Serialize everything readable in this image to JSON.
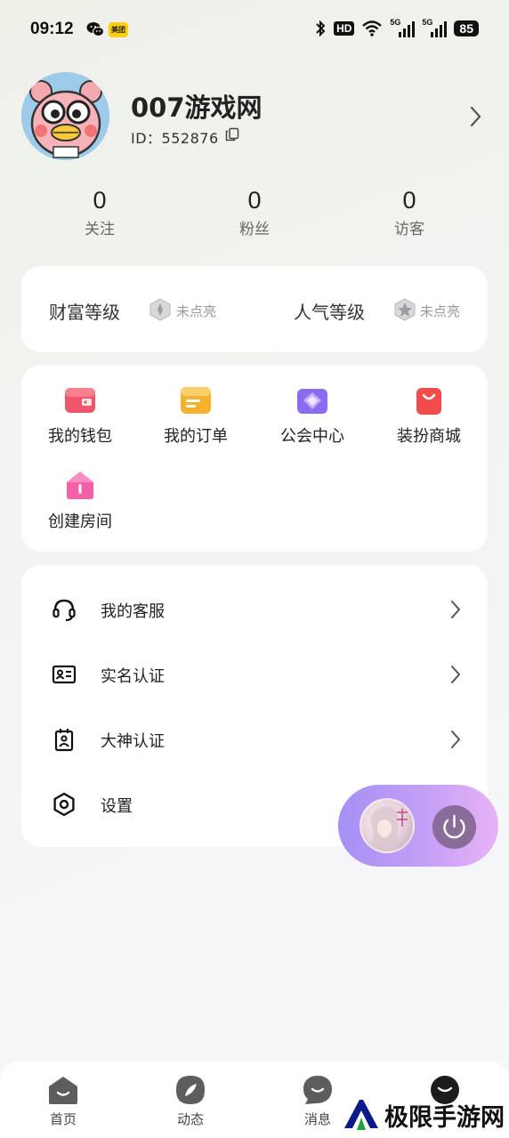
{
  "status_bar": {
    "time": "09:12",
    "meituan_label": "美团",
    "hd_label": "HD",
    "network_1": "5G",
    "network_2": "5G",
    "battery": "85"
  },
  "profile": {
    "name": "007游戏网",
    "id_text": "ID：552876"
  },
  "stats": [
    {
      "value": "0",
      "label": "关注"
    },
    {
      "value": "0",
      "label": "粉丝"
    },
    {
      "value": "0",
      "label": "访客"
    }
  ],
  "levels": [
    {
      "title": "财富等级",
      "status": "未点亮"
    },
    {
      "title": "人气等级",
      "status": "未点亮"
    }
  ],
  "features": [
    {
      "label": "我的钱包",
      "icon": "wallet-icon",
      "color": "#f0566a"
    },
    {
      "label": "我的订单",
      "icon": "order-icon",
      "color": "#f6b22f"
    },
    {
      "label": "公会中心",
      "icon": "guild-icon",
      "color": "#8a6cf0"
    },
    {
      "label": "装扮商城",
      "icon": "shop-bag-icon",
      "color": "#f24b4b"
    },
    {
      "label": "创建房间",
      "icon": "house-icon",
      "color": "#f55fa8"
    }
  ],
  "menu": [
    {
      "label": "我的客服",
      "icon": "headset-icon"
    },
    {
      "label": "实名认证",
      "icon": "id-card-icon"
    },
    {
      "label": "大神认证",
      "icon": "badge-icon"
    },
    {
      "label": "设置",
      "icon": "gear-icon"
    }
  ],
  "nav": [
    {
      "label": "首页",
      "icon": "home-icon"
    },
    {
      "label": "动态",
      "icon": "feed-icon"
    },
    {
      "label": "消息",
      "icon": "message-icon"
    },
    {
      "label": "",
      "icon": "profile-icon"
    }
  ],
  "watermark": {
    "text": "极限手游网"
  }
}
